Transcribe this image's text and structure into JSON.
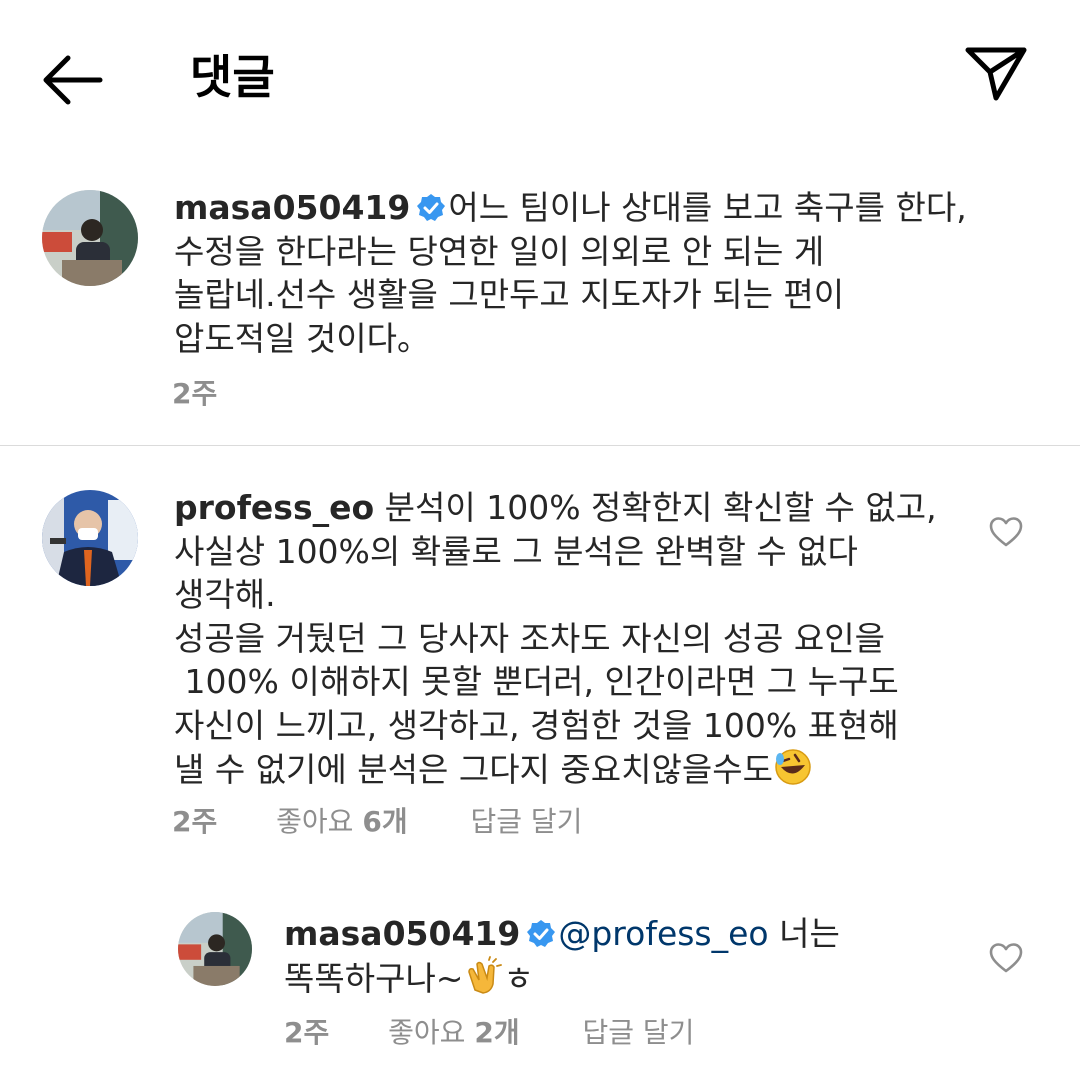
{
  "header": {
    "title": "댓글"
  },
  "comments": [
    {
      "username": "masa050419",
      "verified": true,
      "text_lines": [
        "어느 팀이나 상대를 보고 축구를 한다,",
        "수정을 한다라는 당연한 일이 의외로 안 되는 게",
        "놀랍네.선수 생활을 그만두고 지도자가 되는 편이",
        "압도적일 것이다。"
      ],
      "time": "2주"
    },
    {
      "username": "profess_eo",
      "verified": false,
      "text_lines": [
        "분석이 100% 정확한지 확신할 수 없고,",
        "사실상 100%의 확률로 그 분석은 완벽할 수 없다",
        "생각해.",
        "성공을 거뒀던 그 당사자 조차도 자신의 성공 요인을",
        " 100% 이해하지 못할 뿐더러, 인간이라면 그 누구도",
        "자신이 느끼고, 생각하고, 경험한 것을 100% 표현해",
        "낼 수 없기에 분석은 그다지 중요치않을수도"
      ],
      "emoji": "rolling-on-floor-laughing-emoji",
      "time": "2주",
      "likes_label": "좋아요",
      "likes_count": "6개",
      "reply_label": "답글 달기"
    },
    {
      "username": "masa050419",
      "verified": true,
      "mention": "@profess_eo",
      "text_first": " 너는",
      "text_second": "똑똑하구나~",
      "text_after_emoji": "ㅎ",
      "emoji": "clapping-hands-emoji",
      "time": "2주",
      "likes_label": "좋아요",
      "likes_count": "2개",
      "reply_label": "답글 달기"
    }
  ],
  "colors": {
    "text": "#262626",
    "meta": "#8e8e8e",
    "verified": "#3897f0",
    "mention": "#00376b",
    "divider": "#dbdbdb"
  }
}
